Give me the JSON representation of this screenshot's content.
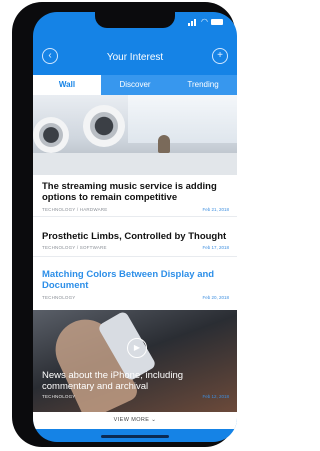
{
  "header": {
    "title": "Your Interest",
    "back_icon": "back-icon",
    "add_icon": "add-icon"
  },
  "tabs": [
    {
      "label": "Wall",
      "active": true
    },
    {
      "label": "Discover",
      "active": false
    },
    {
      "label": "Trending",
      "active": false
    }
  ],
  "articles": [
    {
      "headline": "The streaming music service is adding options to remain competitive",
      "category": "TECHNOLOGY / HARDWARE",
      "date": "Feb 21, 2018",
      "image": "speakers-photo"
    },
    {
      "headline": "Prosthetic Limbs, Controlled by Thought",
      "category": "TECHNOLOGY / SOFTWARE",
      "date": "Feb 17, 2018"
    },
    {
      "headline": "Matching Colors Between Display and Document",
      "category": "TECHNOLOGY",
      "date": "Feb 20, 2018",
      "highlight": true
    },
    {
      "headline": "News about the iPhone, including commentary and archival",
      "category": "TECHNOLOGY",
      "date": "Feb 12, 2018",
      "image": "iphone-photo",
      "has_video": true
    }
  ],
  "footer": {
    "view_more_label": "VIEW MORE"
  },
  "colors": {
    "accent": "#1583e6",
    "tab_inactive": "#3797ee",
    "highlight_text": "#2d8fe8"
  }
}
